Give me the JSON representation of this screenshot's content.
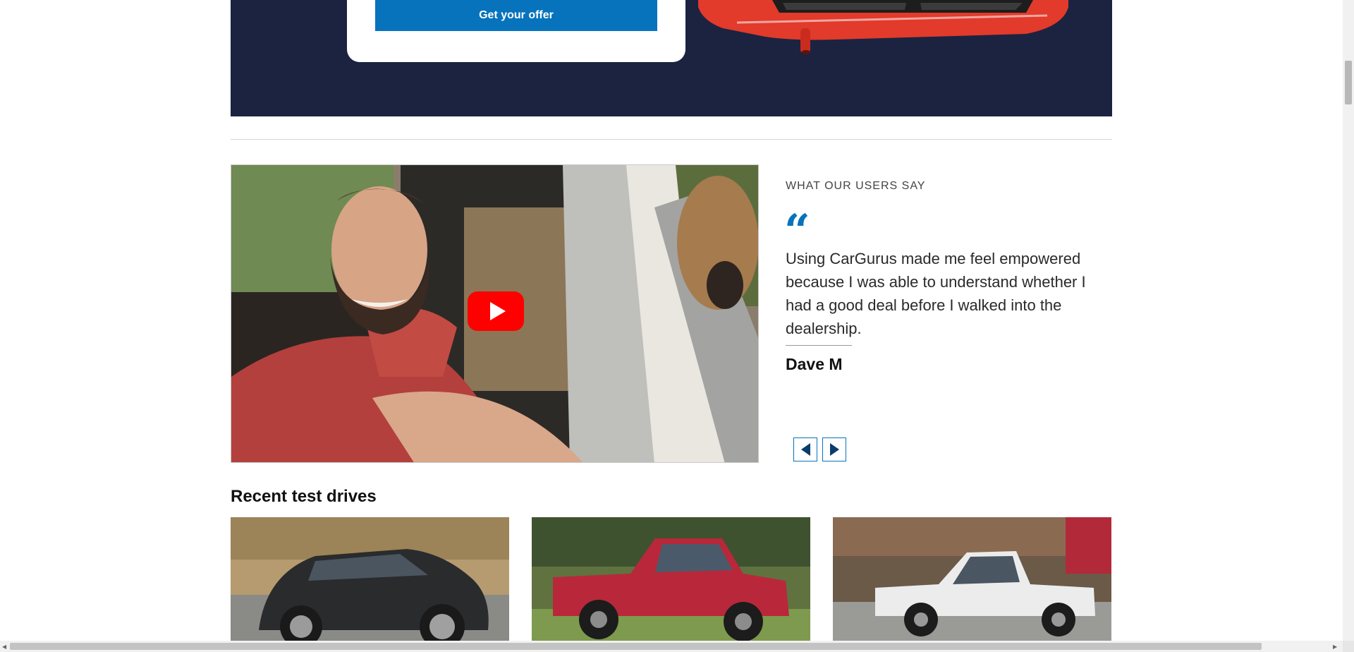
{
  "banner": {
    "offer_button_label": "Get your offer",
    "background_color": "#1b2340",
    "button_color": "#0773bc"
  },
  "video": {
    "play_icon": "youtube-play-icon",
    "play_color": "#ff0000"
  },
  "testimonial": {
    "eyebrow": "WHAT OUR USERS SAY",
    "quote_icon": "quote-icon",
    "quote": "Using CarGurus made me feel empowered because I was able to understand whether I had a good deal before I walked into the dealership.",
    "author": "Dave M",
    "prev_icon": "chevron-left-icon",
    "next_icon": "chevron-right-icon",
    "accent_color": "#0773bc"
  },
  "recent_test_drives": {
    "title": "Recent test drives"
  }
}
